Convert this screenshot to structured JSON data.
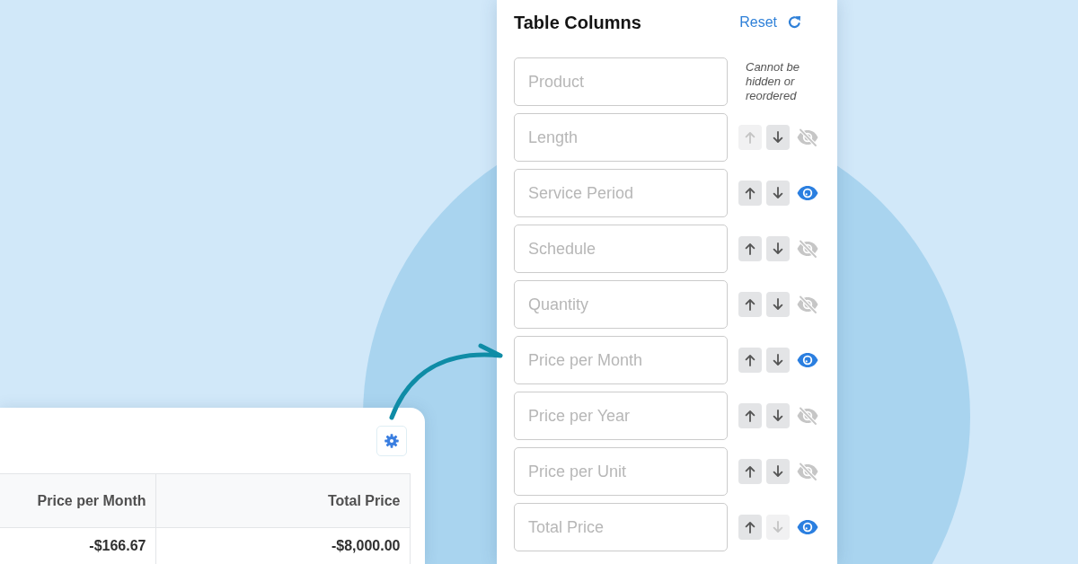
{
  "panel": {
    "title": "Table Columns",
    "reset": {
      "label": "Reset"
    },
    "columns": [
      {
        "kind": "fixed",
        "placeholder": "Product",
        "note": "Cannot be hidden or reordered"
      },
      {
        "kind": "movable",
        "placeholder": "Length",
        "up_disabled": true,
        "down_disabled": false,
        "visible": false
      },
      {
        "kind": "movable",
        "placeholder": "Service Period",
        "up_disabled": false,
        "down_disabled": false,
        "visible": true
      },
      {
        "kind": "movable",
        "placeholder": "Schedule",
        "up_disabled": false,
        "down_disabled": false,
        "visible": false
      },
      {
        "kind": "movable",
        "placeholder": "Quantity",
        "up_disabled": false,
        "down_disabled": false,
        "visible": false
      },
      {
        "kind": "movable",
        "placeholder": "Price per Month",
        "up_disabled": false,
        "down_disabled": false,
        "visible": true
      },
      {
        "kind": "movable",
        "placeholder": "Price per Year",
        "up_disabled": false,
        "down_disabled": false,
        "visible": false
      },
      {
        "kind": "movable",
        "placeholder": "Price per Unit",
        "up_disabled": false,
        "down_disabled": false,
        "visible": false
      },
      {
        "kind": "movable",
        "placeholder": "Total Price",
        "up_disabled": false,
        "down_disabled": true,
        "visible": true
      }
    ]
  },
  "card": {
    "table": {
      "columns": [
        "Price per Month",
        "Total Price"
      ],
      "rows": [
        [
          "-$166.67",
          "-$8,000.00"
        ]
      ]
    }
  }
}
